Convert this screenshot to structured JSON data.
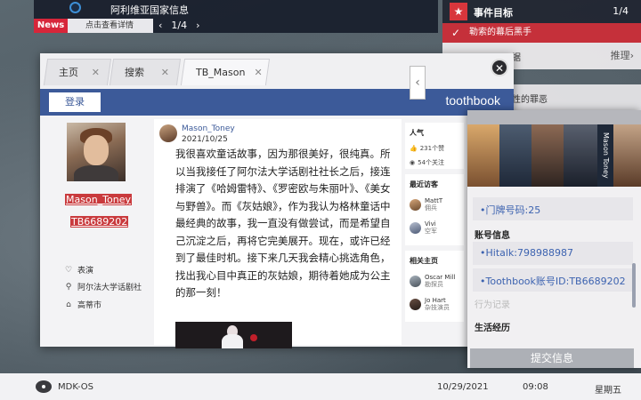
{
  "news": {
    "title": "阿利维亚国家信息",
    "label": "News",
    "detail": "点击查看详情",
    "prev": "‹",
    "page": "1/4",
    "next": "›"
  },
  "event": {
    "title": "事件目标",
    "count": "1/4",
    "item": "勒索的幕后黑手",
    "sub1_text": "据",
    "sub1_right": "推理›",
    "sub2_text": "性的罪恶"
  },
  "browser": {
    "tabs": [
      {
        "label": "主页",
        "close": "✕"
      },
      {
        "label": "搜索",
        "close": "✕"
      },
      {
        "label": "TB_Mason",
        "close": "✕"
      }
    ],
    "close": "✕",
    "login": "登录",
    "brand": "toothbook"
  },
  "profile": {
    "name": "Mason_Toney",
    "id": "TB6689202",
    "rows": [
      {
        "icon": "♡",
        "text": "表演"
      },
      {
        "icon": "⚲",
        "text": "阿尔法大学话剧社"
      },
      {
        "icon": "⌂",
        "text": "高蒂市"
      }
    ]
  },
  "post": {
    "user": "Mason_Toney",
    "date": "2021/10/25",
    "body": "我很喜欢童话故事，因为那很美好，很纯真。所以当我接任了阿尔法大学话剧社社长之后，接连排演了《哈姆雷特》、《罗密欧与朱丽叶》、《美女与野兽》。而《灰姑娘》，作为我认为格林童话中最经典的故事，我一直没有做尝试，而是希望自己沉淀之后，再将它完美展开。现在，或许已经到了最佳时机。接下来几天我会精心挑选角色，找出我心目中真正的灰姑娘，期待着她成为公主的那一刻！"
  },
  "sidebar": {
    "popularity_title": "人气",
    "likes": "231个赞",
    "follows": "54个关注",
    "visitors_title": "最近访客",
    "visitors": [
      {
        "name": "MattT",
        "role": "佣兵"
      },
      {
        "name": "Vivi",
        "role": "空军"
      }
    ],
    "related_title": "相关主页",
    "related": [
      {
        "name": "Oscar Mill",
        "role": "勘探员"
      },
      {
        "name": "Jo Hart",
        "role": "杂技演员"
      }
    ],
    "arrow": "‹"
  },
  "phone": {
    "strip_name": "Mason Toney",
    "door": "•门牌号码:25",
    "account_label": "账号信息",
    "hitalk": "•Hitalk:798988987",
    "toothbook": "•Toothbook账号ID:TB6689202",
    "record": "行为记录",
    "history": "生活经历",
    "submit": "提交信息"
  },
  "taskbar": {
    "os": "MDK-OS",
    "date": "10/29/2021",
    "time": "09:08",
    "day": "星期五"
  },
  "colors": {
    "accent_blue": "#3c5a99",
    "highlight_red": "#c93a3d",
    "event_red": "#c5303a"
  }
}
